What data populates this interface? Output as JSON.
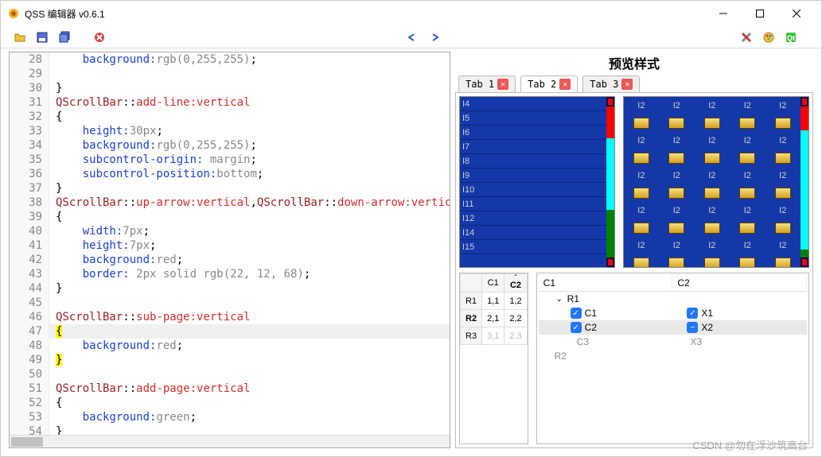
{
  "window": {
    "title": "QSS 编辑器 v0.6.1"
  },
  "preview_title": "预览样式",
  "tabs": [
    {
      "label": "Tab 1",
      "active": false
    },
    {
      "label": "Tab 2",
      "active": true
    },
    {
      "label": "Tab 3",
      "active": false
    }
  ],
  "code_lines": [
    {
      "n": 28,
      "tokens": [
        [
          "    ",
          ""
        ],
        [
          "background:",
          "tk-prop"
        ],
        [
          "rgb(0,255,255)",
          "tk-rgb"
        ],
        [
          ";",
          "tk-punct"
        ]
      ]
    },
    {
      "n": 29,
      "tokens": []
    },
    {
      "n": 30,
      "tokens": [
        [
          "}",
          "tk-punct"
        ]
      ]
    },
    {
      "n": 31,
      "tokens": [
        [
          "QScrollBar",
          "tk-sel"
        ],
        [
          "::",
          "tk-punct"
        ],
        [
          "add-line",
          "tk-psel"
        ],
        [
          ":vertical",
          "tk-psel"
        ]
      ]
    },
    {
      "n": 32,
      "tokens": [
        [
          "{",
          "tk-punct"
        ]
      ]
    },
    {
      "n": 33,
      "tokens": [
        [
          "    ",
          ""
        ],
        [
          "height:",
          "tk-prop"
        ],
        [
          "30px",
          "tk-val"
        ],
        [
          ";",
          "tk-punct"
        ]
      ]
    },
    {
      "n": 34,
      "tokens": [
        [
          "    ",
          ""
        ],
        [
          "background:",
          "tk-prop"
        ],
        [
          "rgb(0,255,255)",
          "tk-rgb"
        ],
        [
          ";",
          "tk-punct"
        ]
      ]
    },
    {
      "n": 35,
      "tokens": [
        [
          "    ",
          ""
        ],
        [
          "subcontrol-origin:",
          "tk-prop"
        ],
        [
          " margin",
          "tk-val"
        ],
        [
          ";",
          "tk-punct"
        ]
      ]
    },
    {
      "n": 36,
      "tokens": [
        [
          "    ",
          ""
        ],
        [
          "subcontrol-position:",
          "tk-prop"
        ],
        [
          "bottom",
          "tk-val"
        ],
        [
          ";",
          "tk-punct"
        ]
      ]
    },
    {
      "n": 37,
      "tokens": [
        [
          "}",
          "tk-punct"
        ]
      ]
    },
    {
      "n": 38,
      "tokens": [
        [
          "QScrollBar",
          "tk-sel"
        ],
        [
          "::",
          "tk-punct"
        ],
        [
          "up-arrow",
          "tk-psel"
        ],
        [
          ":vertical",
          "tk-psel"
        ],
        [
          ",",
          "tk-punct"
        ],
        [
          "QScrollBar",
          "tk-sel"
        ],
        [
          "::",
          "tk-punct"
        ],
        [
          "down-arrow",
          "tk-psel"
        ],
        [
          ":vertical",
          "tk-psel"
        ]
      ]
    },
    {
      "n": 39,
      "tokens": [
        [
          "{",
          "tk-punct"
        ]
      ]
    },
    {
      "n": 40,
      "tokens": [
        [
          "    ",
          ""
        ],
        [
          "width:",
          "tk-prop"
        ],
        [
          "7px",
          "tk-val"
        ],
        [
          ";",
          "tk-punct"
        ]
      ]
    },
    {
      "n": 41,
      "tokens": [
        [
          "    ",
          ""
        ],
        [
          "height:",
          "tk-prop"
        ],
        [
          "7px",
          "tk-val"
        ],
        [
          ";",
          "tk-punct"
        ]
      ]
    },
    {
      "n": 42,
      "tokens": [
        [
          "    ",
          ""
        ],
        [
          "background:",
          "tk-prop"
        ],
        [
          "red",
          "tk-val"
        ],
        [
          ";",
          "tk-punct"
        ]
      ]
    },
    {
      "n": 43,
      "tokens": [
        [
          "    ",
          ""
        ],
        [
          "border:",
          "tk-prop"
        ],
        [
          " 2px solid rgb(22, 12, 68)",
          "tk-rgb"
        ],
        [
          ";",
          "tk-punct"
        ]
      ]
    },
    {
      "n": 44,
      "tokens": [
        [
          "}",
          "tk-punct"
        ]
      ]
    },
    {
      "n": 45,
      "tokens": []
    },
    {
      "n": 46,
      "tokens": [
        [
          "QScrollBar",
          "tk-sel"
        ],
        [
          "::",
          "tk-punct"
        ],
        [
          "sub-page",
          "tk-psel"
        ],
        [
          ":vertical",
          "tk-psel"
        ]
      ]
    },
    {
      "n": 47,
      "tokens": [
        [
          "{",
          "brace-hl"
        ]
      ],
      "highlight": true
    },
    {
      "n": 48,
      "tokens": [
        [
          "    ",
          ""
        ],
        [
          "background:",
          "tk-prop"
        ],
        [
          "red",
          "tk-val"
        ],
        [
          ";",
          "tk-punct"
        ]
      ]
    },
    {
      "n": 49,
      "tokens": [
        [
          "}",
          "brace-hl"
        ]
      ]
    },
    {
      "n": 50,
      "tokens": []
    },
    {
      "n": 51,
      "tokens": [
        [
          "QScrollBar",
          "tk-sel"
        ],
        [
          "::",
          "tk-punct"
        ],
        [
          "add-page",
          "tk-psel"
        ],
        [
          ":vertical",
          "tk-psel"
        ]
      ]
    },
    {
      "n": 52,
      "tokens": [
        [
          "{",
          "tk-punct"
        ]
      ]
    },
    {
      "n": 53,
      "tokens": [
        [
          "    ",
          ""
        ],
        [
          "background:",
          "tk-prop"
        ],
        [
          "green",
          "tk-val"
        ],
        [
          ";",
          "tk-punct"
        ]
      ]
    },
    {
      "n": 54,
      "tokens": [
        [
          "}",
          "tk-punct"
        ]
      ]
    }
  ],
  "list_items": [
    "I4",
    "I5",
    "I6",
    "I7",
    "I8",
    "I9",
    "I10",
    "I11",
    "I12",
    "I14",
    "I15"
  ],
  "grid_label": "I2",
  "table": {
    "cols": [
      "C1",
      "C2"
    ],
    "sort_col": "C2",
    "rows": [
      {
        "h": "R1",
        "c": [
          "1,1",
          "1,2"
        ],
        "bold": false
      },
      {
        "h": "R2",
        "c": [
          "2,1",
          "2,2"
        ],
        "bold": true
      },
      {
        "h": "R3",
        "c": [
          "3,1",
          "2,3"
        ],
        "bold": false,
        "disabled": true
      }
    ]
  },
  "tree": {
    "cols": [
      "C1",
      "C2"
    ],
    "r1": "R1",
    "r2": "R2",
    "items": [
      {
        "c1": "C1",
        "c1chk": "on",
        "c2": "X1",
        "c2chk": "on"
      },
      {
        "c1": "C2",
        "c1chk": "on",
        "c2": "X2",
        "c2chk": "partial",
        "sel": true
      },
      {
        "c1": "C3",
        "c2": "X3",
        "plain": true
      }
    ]
  },
  "watermark": "CSDN @勿在浮沙筑高台"
}
